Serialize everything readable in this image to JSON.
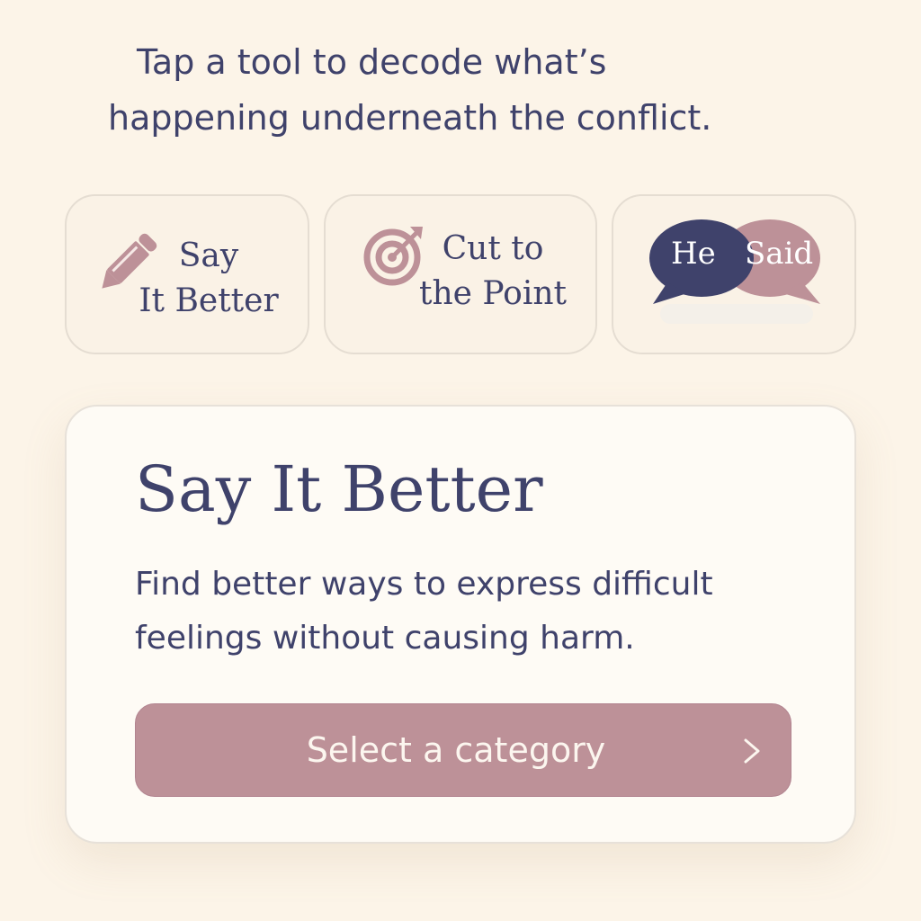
{
  "intro": {
    "line1": "Tap a tool to decode what’s",
    "line2": "happening underneath the conflict."
  },
  "tools": [
    {
      "line1": "Say",
      "line2": "It Better",
      "icon": "pencil-icon"
    },
    {
      "line1": "Cut to",
      "line2": "the Point",
      "icon": "target-icon"
    },
    {
      "bubble_left": "He",
      "bubble_right": "Said",
      "icon": "speech-bubbles-icon"
    }
  ],
  "detail": {
    "title": "Say It Better",
    "desc_line1": "Find better ways to express difficult",
    "desc_line2": "feelings without causing harm.",
    "cta_label": "Select a category",
    "cta_icon": "chevron-right-icon"
  },
  "colors": {
    "background": "#fcf4e8",
    "navy": "#3f426b",
    "mauve": "#bd9198",
    "card": "#fefbf5"
  }
}
